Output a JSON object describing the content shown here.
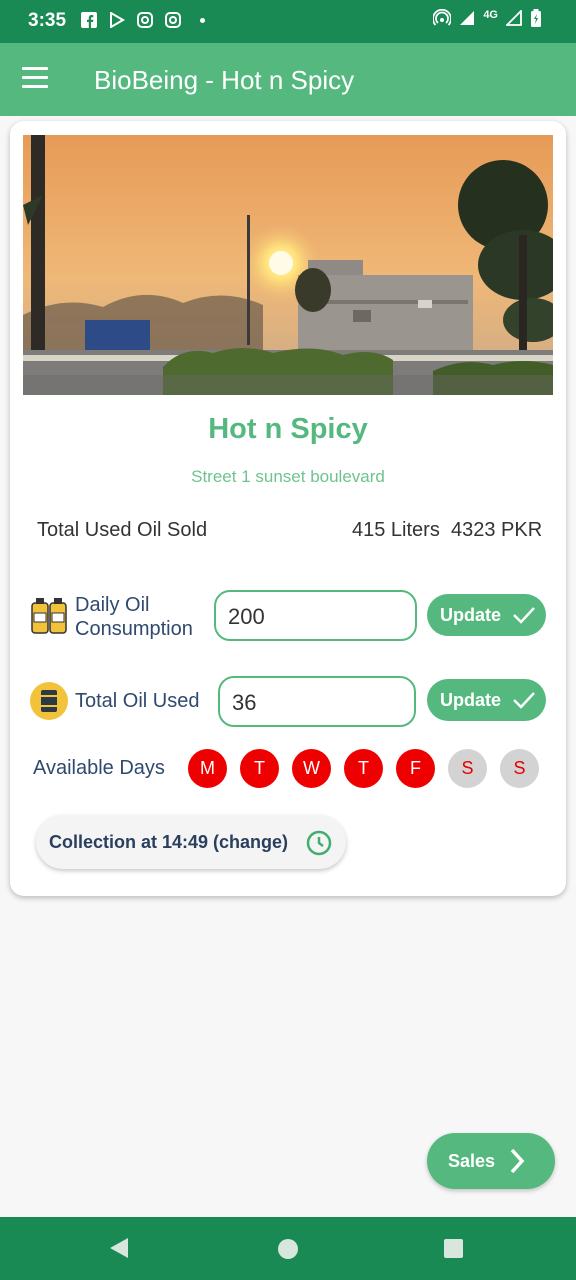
{
  "status_bar": {
    "time": "3:35",
    "left_icons": [
      "facebook-icon",
      "play-store-icon",
      "instagram-icon",
      "instagram-icon"
    ],
    "network": "4G",
    "right_icons": [
      "hotspot-icon",
      "signal-icon",
      "signal-icon",
      "battery-icon"
    ]
  },
  "app_bar": {
    "title": "BioBeing - Hot n Spicy",
    "menu_icon": "hamburger-menu-icon"
  },
  "restaurant": {
    "name": "Hot n Spicy",
    "address": "Street 1 sunset boulevard",
    "image": "sunset-street-photo"
  },
  "sold": {
    "label": "Total Used Oil Sold",
    "liters": "415 Liters",
    "pkr": "4323 PKR"
  },
  "daily": {
    "label_line1": "Daily Oil",
    "label_line2": "Consumption",
    "value": "200",
    "button": "Update",
    "icon": "oil-bottles-icon"
  },
  "total": {
    "label": "Total Oil Used",
    "value": "36",
    "button": "Update",
    "icon": "oil-barrel-icon"
  },
  "days": {
    "label": "Available Days",
    "items": [
      {
        "letter": "M",
        "available": true
      },
      {
        "letter": "T",
        "available": true
      },
      {
        "letter": "W",
        "available": true
      },
      {
        "letter": "T",
        "available": true
      },
      {
        "letter": "F",
        "available": true
      },
      {
        "letter": "S",
        "available": false
      },
      {
        "letter": "S",
        "available": false
      }
    ]
  },
  "collection": {
    "text": "Collection at 14:49 (change)",
    "icon": "clock-icon"
  },
  "sales_button": {
    "label": "Sales",
    "icon": "chevron-right-icon"
  },
  "colors": {
    "primary": "#55b97f",
    "primary_dark": "#1a8a55",
    "day_on": "#ee0000",
    "day_off": "#d3d3d3"
  }
}
